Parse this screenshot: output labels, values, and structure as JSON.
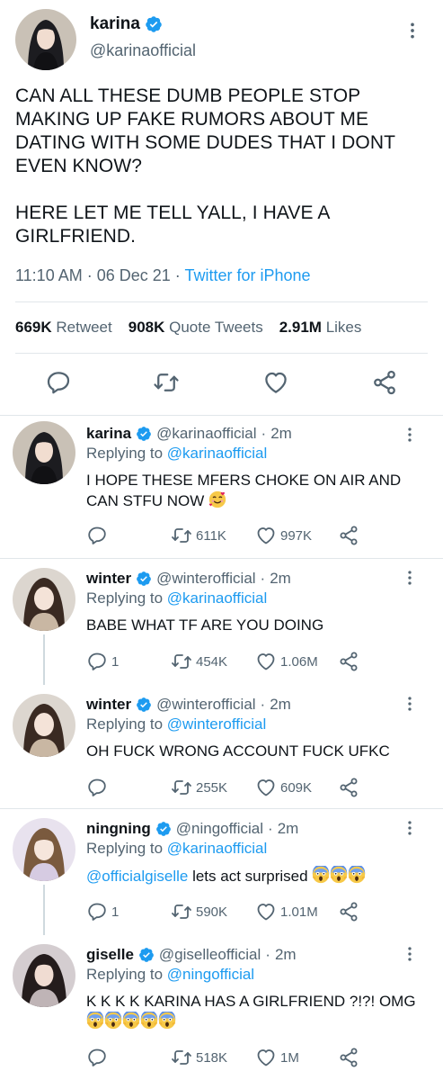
{
  "main_tweet": {
    "name": "karina",
    "handle": "@karinaofficial",
    "text": [
      "CAN ALL THESE DUMB PEOPLE STOP MAKING UP FAKE RUMORS ABOUT ME DATING WITH SOME DUDES THAT I DONT EVEN KNOW?",
      "HERE LET ME TELL YALL, I HAVE A GIRLFRIEND."
    ],
    "time": "11:10 AM · 06 Dec 21 · ",
    "source": "Twitter for iPhone",
    "stats": {
      "retweets_count": "669K",
      "retweets_label": "Retweet",
      "quotes_count": "908K",
      "quotes_label": "Quote Tweets",
      "likes_count": "2.91M",
      "likes_label": "Likes"
    }
  },
  "replies": [
    {
      "name": "karina",
      "handle": "@karinaofficial",
      "dot": "·",
      "time": "2m",
      "replying_label": "Replying to",
      "replying_to": "@karinaofficial",
      "text": "I HOPE THESE MFERS CHOKE ON AIR AND CAN STFU NOW",
      "reply_count": "",
      "retweet_count": "611K",
      "like_count": "997K"
    },
    {
      "name": "winter",
      "handle": "@winterofficial",
      "dot": "·",
      "time": "2m",
      "replying_label": "Replying to",
      "replying_to": "@karinaofficial",
      "text": "BABE WHAT TF ARE YOU DOING",
      "reply_count": "1",
      "retweet_count": "454K",
      "like_count": "1.06M"
    },
    {
      "name": "winter",
      "handle": "@winterofficial",
      "dot": "·",
      "time": "2m",
      "replying_label": "Replying to",
      "replying_to": "@winterofficial",
      "text": "OH FUCK WRONG ACCOUNT FUCK UFKC",
      "reply_count": "",
      "retweet_count": "255K",
      "like_count": "609K"
    },
    {
      "name": "ningning",
      "handle": "@ningofficial",
      "dot": "·",
      "time": "2m",
      "replying_label": "Replying to",
      "replying_to": "@karinaofficial",
      "mention": "@officialgiselle",
      "text": " lets act surprised",
      "reply_count": "1",
      "retweet_count": "590K",
      "like_count": "1.01M"
    },
    {
      "name": "giselle",
      "handle": "@giselleofficial",
      "dot": "·",
      "time": "2m",
      "replying_label": "Replying to",
      "replying_to": "@ningofficial",
      "text": "K K K K KARINA HAS A GIRLFRIEND ?!?! OMG",
      "reply_count": "",
      "retweet_count": "518K",
      "like_count": "1M"
    }
  ],
  "icons": {
    "verified": "verified-badge-icon",
    "more": "more-vertical-icon",
    "reply": "reply-icon",
    "retweet": "retweet-icon",
    "like": "heart-icon",
    "share": "share-icon"
  },
  "colors": {
    "accent": "#1d9bf0",
    "secondary_text": "#536471",
    "icon": "#536471",
    "divider": "#e1e6ea"
  }
}
